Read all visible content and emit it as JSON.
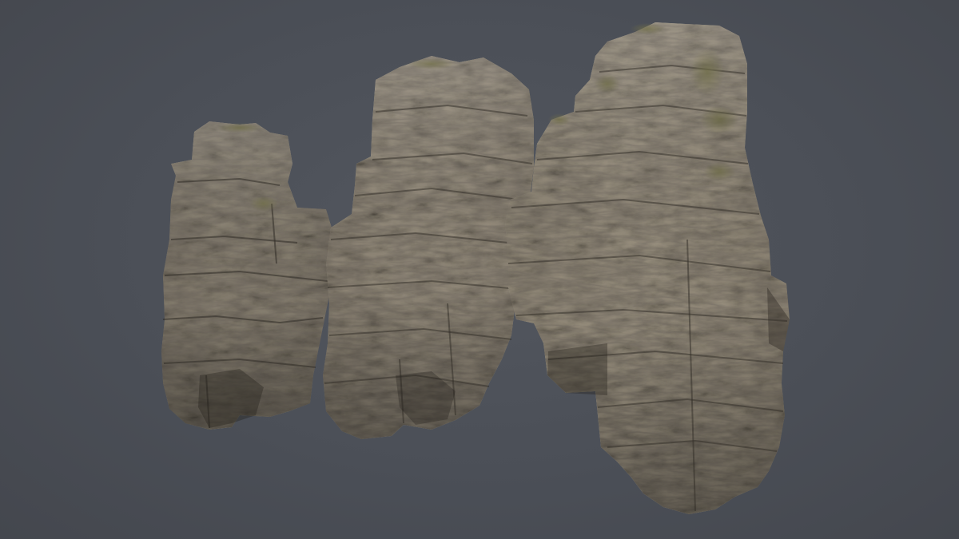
{
  "scene": {
    "background_color": "#4a4e56",
    "subject": "rock-pillars",
    "rock_colors": {
      "base": "#8a8273",
      "light": "#b3ab9b",
      "dark": "#3e3a33",
      "moss": "#6e6b4c"
    },
    "pillars": [
      {
        "id": "left-pillar",
        "icon": "rock-pillar-icon"
      },
      {
        "id": "middle-pillar",
        "icon": "rock-pillar-icon"
      },
      {
        "id": "right-pillar",
        "icon": "rock-pillar-icon"
      }
    ]
  }
}
